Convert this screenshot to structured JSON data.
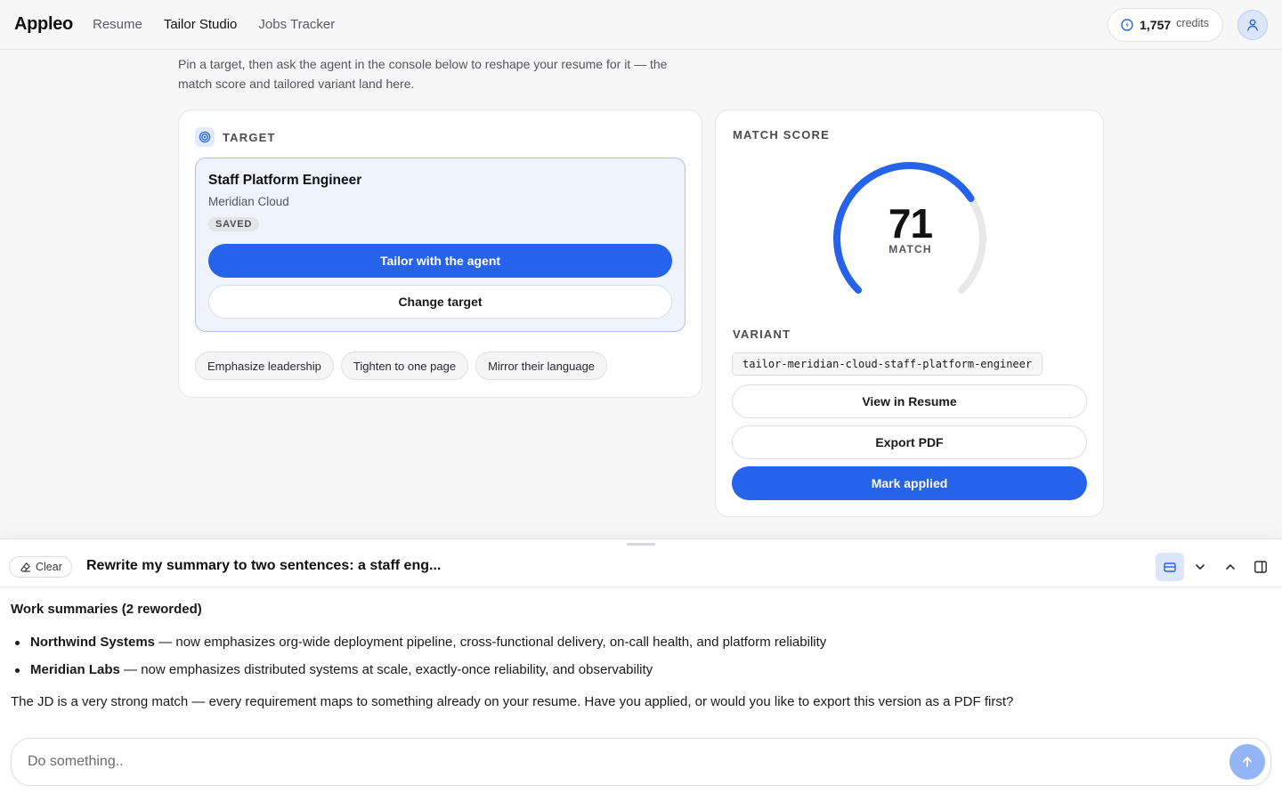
{
  "nav": {
    "brand": "Appleo",
    "links": [
      "Resume",
      "Tailor Studio",
      "Jobs Tracker"
    ],
    "active": "Tailor Studio",
    "credits_value": "1,757",
    "credits_label": "credits"
  },
  "intro": "Pin a target, then ask the agent in the console below to reshape your resume for it — the match score and tailored variant land here.",
  "target": {
    "eyebrow": "TARGET",
    "job_title": "Staff Platform Engineer",
    "company": "Meridian Cloud",
    "status_badge": "SAVED",
    "tailor_label": "Tailor with the agent",
    "change_label": "Change target",
    "chips": [
      "Emphasize leadership",
      "Tighten to one page",
      "Mirror their language"
    ]
  },
  "score": {
    "eyebrow": "MATCH SCORE",
    "value": "71",
    "value_num": 71,
    "max": 100,
    "label": "MATCH",
    "variant_eyebrow": "VARIANT",
    "variant_code": "tailor-meridian-cloud-staff-platform-engineer",
    "view_label": "View in Resume",
    "export_label": "Export PDF",
    "applied_label": "Mark applied"
  },
  "console": {
    "clear_label": "Clear",
    "title": "Rewrite my summary to two sentences: a staff eng...",
    "heading": "Work summaries (2 reworded)",
    "items": [
      {
        "company": "Northwind Systems",
        "text": " — now emphasizes org-wide deployment pipeline, cross-functional delivery, on-call health, and platform reliability"
      },
      {
        "company": "Meridian Labs",
        "text": " — now emphasizes distributed systems at scale, exactly-once reliability, and observability"
      }
    ],
    "message": "The JD is a very strong match — every requirement maps to something already on your resume. Have you applied, or would you like to export this version as a PDF first?",
    "input_placeholder": "Do something..",
    "icons": [
      "compact-view-icon",
      "chevron-down-icon",
      "chevron-up-icon",
      "side-panel-icon"
    ]
  },
  "colors": {
    "accent": "#2563eb",
    "accent_soft": "#93b4f5",
    "target_bg": "#eef3fd",
    "gauge_track": "#e8e8ea"
  }
}
